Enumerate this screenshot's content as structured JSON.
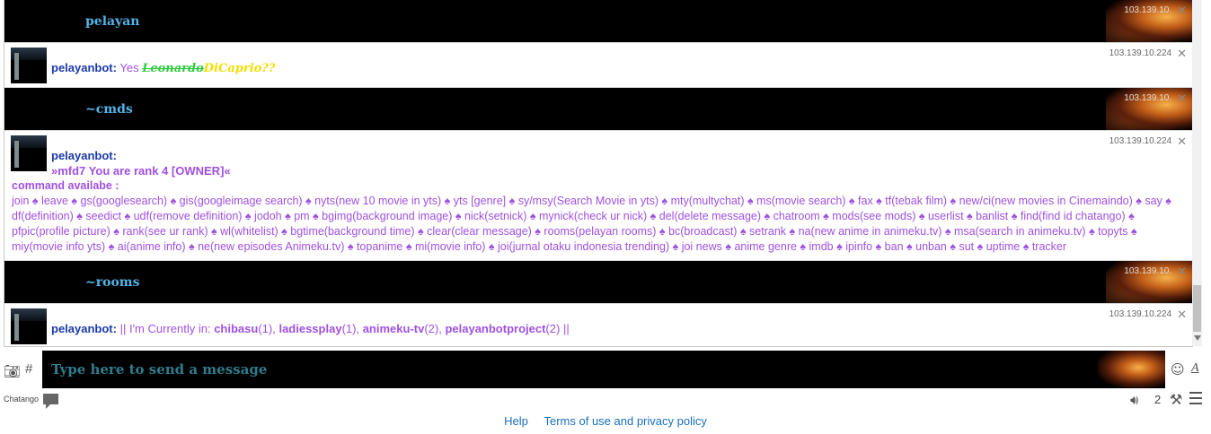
{
  "messages": [
    {
      "type": "dark",
      "text": "pelayan",
      "ip": "103.139.10.224"
    },
    {
      "type": "light",
      "nick": "pelayanbot:",
      "prefix": "Yes",
      "fancy1": "Leonardo",
      "fancy2": "DiCaprio??",
      "ip": "103.139.10.224"
    },
    {
      "type": "dark",
      "text": "~cmds",
      "ip": "103.139.10.224"
    },
    {
      "type": "light",
      "nick": "pelayanbot:",
      "rank_line": "»mfd7 You are rank 4 [OWNER]«",
      "cmd_title": "command availabe :",
      "commands": "join ♠ leave ♠ gs(googlesearch) ♠ gis(googleimage search) ♠ nyts(new 10 movie in yts) ♠ yts [genre] ♠ sy/msy(Search Movie in yts) ♠ mty(multychat) ♠ ms(movie search) ♠ fax ♠ tf(tebak film) ♠ new/ci(new movies in Cinemaindo) ♠ say ♠ df(definition) ♠ seedict ♠ udf(remove definition) ♠ jodoh ♠ pm ♠ bgimg(background image) ♠ nick(setnick) ♠ mynick(check ur nick) ♠ del(delete message) ♠ chatroom ♠ mods(see mods) ♠ userlist ♠ banlist ♠ find(find id chatango) ♠ pfpic(profile picture) ♠ rank(see ur rank) ♠ wl(whitelist) ♠ bgtime(background time) ♠ clear(clear message) ♠ rooms(pelayan rooms) ♠ bc(broadcast) ♠ setrank ♠ na(new anime in animeku.tv) ♠ msa(search in animeku.tv) ♠ topyts ♠ miy(movie info yts) ♠ ai(anime info) ♠ ne(new episodes Animeku.tv) ♠ topanime ♠ mi(movie info) ♠ joi(jurnal otaku indonesia trending) ♠ joi news ♠ anime genre ♠ imdb ♠ ipinfo ♠ ban ♠ unban ♠ sut ♠ uptime ♠ tracker",
      "ip": "103.139.10.224"
    },
    {
      "type": "dark",
      "text": "~rooms",
      "ip": "103.139.10.224"
    },
    {
      "type": "light",
      "nick": "pelayanbot:",
      "rooms_prefix": "|| I'm Currently in:",
      "rooms": [
        {
          "name": "chibasu",
          "count": "(1),"
        },
        {
          "name": "ladiessplay",
          "count": "(1),"
        },
        {
          "name": "animeku-tv",
          "count": "(2),"
        },
        {
          "name": "pelayanbotproject",
          "count": "(2)"
        }
      ],
      "rooms_suffix": "||",
      "ip": "103.139.10.224"
    }
  ],
  "ip_truncated": "103.139.10.",
  "close_glyph": "✕",
  "input": {
    "placeholder": "Type here to send a message"
  },
  "toolbar": {
    "hash": "#",
    "camera_icon": "camera-icon",
    "emoji_icon": "smile-icon",
    "font_icon": "font-icon",
    "font_label": "A"
  },
  "footer": {
    "brand": "Chatango",
    "help": "Help",
    "terms": "Terms of use and privacy policy",
    "user_count": "2",
    "speaker_icon": "speaker-icon",
    "mod_icon": "hammer-icon",
    "menu_icon": "menu-icon"
  },
  "colors": {
    "nick": "#1a3aa8",
    "bot_text": "#a050e0",
    "dark_header_text": "#52b4e8",
    "link": "#1a6fc0"
  }
}
